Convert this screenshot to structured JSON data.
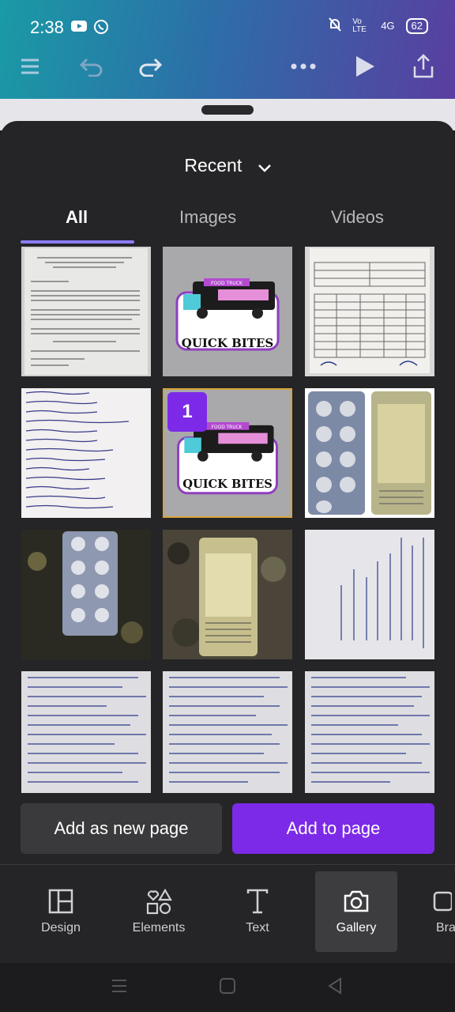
{
  "status": {
    "time": "2:38",
    "network": "4G",
    "battery": "62",
    "volte": "Vo LTE"
  },
  "toolbar": {
    "icons": [
      "menu-icon",
      "undo-icon",
      "redo-icon",
      "more-icon",
      "play-icon",
      "share-icon"
    ]
  },
  "picker": {
    "title": "Recent",
    "tabs": [
      {
        "label": "All"
      },
      {
        "label": "Images"
      },
      {
        "label": "Videos"
      }
    ],
    "selected_badge": "1"
  },
  "grid": {
    "tiles": [
      {
        "kind": "document"
      },
      {
        "kind": "logo",
        "text": "QUICK BITES",
        "tag": "FOOD TRUCK"
      },
      {
        "kind": "table-document"
      },
      {
        "kind": "handwritten-list"
      },
      {
        "kind": "logo",
        "text": "QUICK BITES",
        "tag": "FOOD TRUCK",
        "selected": true
      },
      {
        "kind": "pill-strips"
      },
      {
        "kind": "pill-strip"
      },
      {
        "kind": "pill-strip-floor"
      },
      {
        "kind": "handwritten-page-rotated"
      },
      {
        "kind": "handwritten-page"
      },
      {
        "kind": "handwritten-page"
      },
      {
        "kind": "handwritten-page"
      }
    ]
  },
  "actions": {
    "add_new_page": "Add as new page",
    "add_to_page": "Add to page"
  },
  "nav": {
    "items": [
      {
        "label": "Design",
        "icon": "layout-icon"
      },
      {
        "label": "Elements",
        "icon": "shapes-icon"
      },
      {
        "label": "Text",
        "icon": "text-icon"
      },
      {
        "label": "Gallery",
        "icon": "camera-icon",
        "active": true
      },
      {
        "label": "Bra",
        "icon": "brand-icon"
      }
    ]
  },
  "colors": {
    "accent": "#7d2ae8",
    "tab_underline": "#8b7cf8",
    "sheet": "#252527"
  }
}
